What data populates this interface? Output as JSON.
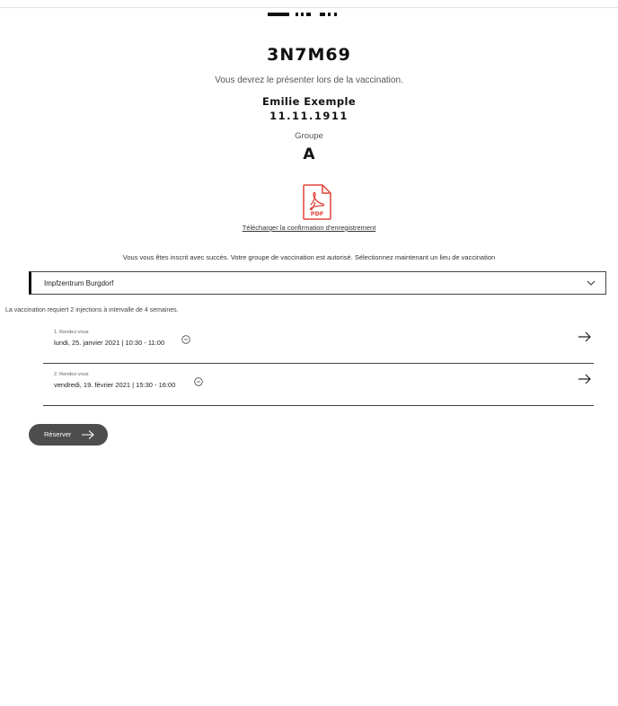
{
  "booking": {
    "code": "3N7M69",
    "present_note": "Vous devrez le présenter lors de la vaccination.",
    "name": "Emilie Exemple",
    "birthdate": "11.11.1911",
    "group_label": "Groupe",
    "group_value": "A"
  },
  "download": {
    "icon": "pdf-icon",
    "icon_text": "PDF",
    "link_label": "Télécharger la confirmation d'enregistrement"
  },
  "status": {
    "success_message": "Vous vous êtes inscrit avec succès. Votre groupe de vaccination est autorisé. Sélectionnez maintenant un lieu de vaccination"
  },
  "location": {
    "selected": "Impfzentrum Burgdorf",
    "icon": "chevron-down-icon"
  },
  "info": {
    "injections_note": "La vaccination requiert 2 injections à intervalle de 4 semaines."
  },
  "appointments": [
    {
      "label": "1. Rendez-vous",
      "datetime": "lundi, 25. janvier 2021 | 10:30 - 11:00"
    },
    {
      "label": "2. Rendez-vous",
      "datetime": "vendredi, 19. février 2021 | 15:30 - 16:00"
    }
  ],
  "actions": {
    "reserve_label": "Réserver"
  },
  "colors": {
    "button_bg": "#4d4d4d",
    "pdf_red": "#e0433a",
    "border": "#444444"
  }
}
